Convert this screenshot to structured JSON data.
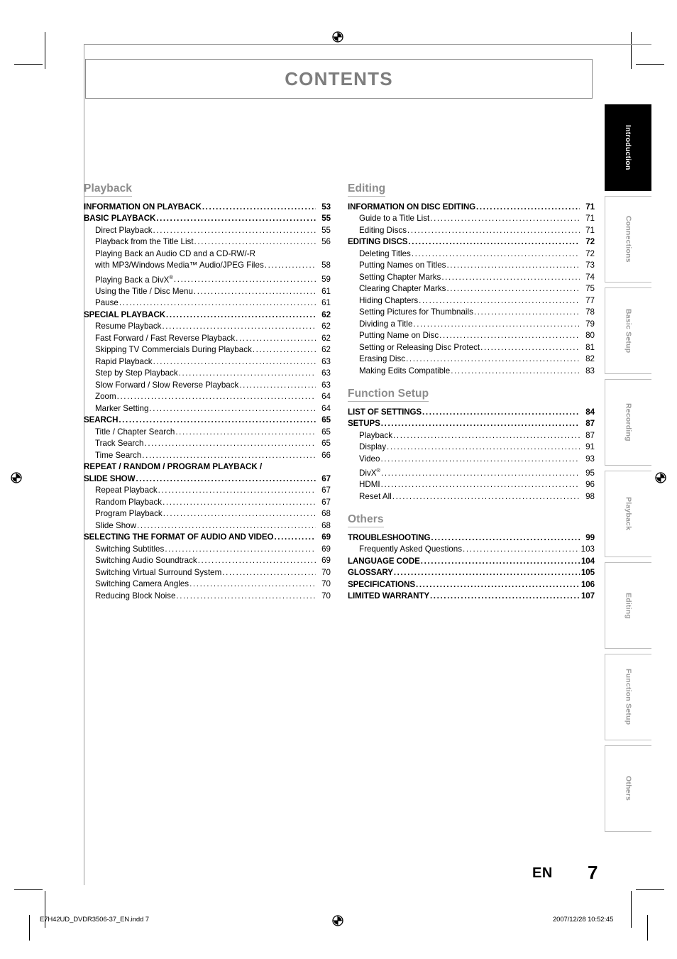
{
  "header": {
    "title": "CONTENTS"
  },
  "page": {
    "lang_code": "EN",
    "number": "7"
  },
  "footer": {
    "file_info": "E7H42UD_DVDR3506-37_EN.indd   7",
    "timestamp": "2007/12/28   10:52:45"
  },
  "tabs": [
    {
      "label": "Introduction",
      "active": true
    },
    {
      "label": "Connections",
      "active": false
    },
    {
      "label": "Basic Setup",
      "active": false
    },
    {
      "label": "Recording",
      "active": false
    },
    {
      "label": "Playback",
      "active": false
    },
    {
      "label": "Editing",
      "active": false
    },
    {
      "label": "Function Setup",
      "active": false
    },
    {
      "label": "Others",
      "active": false
    }
  ],
  "columns": [
    {
      "sections": [
        {
          "heading": "Playback",
          "entries": [
            {
              "level": 1,
              "label": "INFORMATION ON PLAYBACK",
              "page": "53"
            },
            {
              "level": 1,
              "label": "BASIC PLAYBACK",
              "page": "55"
            },
            {
              "level": 2,
              "label": "Direct Playback",
              "page": "55"
            },
            {
              "level": 2,
              "label": "Playback from the Title List",
              "page": "56"
            },
            {
              "level": 2,
              "label": "Playing Back an Audio CD and a CD-RW/-R",
              "page": "",
              "wrap": true
            },
            {
              "level": 2,
              "label": "with MP3/Windows Media™ Audio/JPEG Files",
              "page": "58"
            },
            {
              "level": 2,
              "label": "Playing Back a DivX",
              "sup": "®",
              "page": "59"
            },
            {
              "level": 2,
              "label": "Using the Title / Disc Menu",
              "page": "61"
            },
            {
              "level": 2,
              "label": "Pause",
              "page": "61"
            },
            {
              "level": 1,
              "label": "SPECIAL PLAYBACK",
              "page": "62"
            },
            {
              "level": 2,
              "label": "Resume Playback",
              "page": "62"
            },
            {
              "level": 2,
              "label": "Fast Forward / Fast Reverse Playback",
              "page": "62"
            },
            {
              "level": 2,
              "label": "Skipping TV Commercials During Playback",
              "page": "62"
            },
            {
              "level": 2,
              "label": "Rapid Playback",
              "page": "63"
            },
            {
              "level": 2,
              "label": "Step by Step Playback",
              "page": "63"
            },
            {
              "level": 2,
              "label": "Slow Forward / Slow Reverse Playback",
              "page": "63"
            },
            {
              "level": 2,
              "label": "Zoom",
              "page": "64"
            },
            {
              "level": 2,
              "label": "Marker Setting",
              "page": "64"
            },
            {
              "level": 1,
              "label": "SEARCH",
              "page": "65"
            },
            {
              "level": 2,
              "label": "Title / Chapter Search",
              "page": "65"
            },
            {
              "level": 2,
              "label": "Track Search",
              "page": "65"
            },
            {
              "level": 2,
              "label": "Time Search",
              "page": "66"
            },
            {
              "level": 1,
              "label": "REPEAT / RANDOM / PROGRAM PLAYBACK /",
              "page": "",
              "wrap": true
            },
            {
              "level": 1,
              "label": "SLIDE SHOW",
              "page": "67"
            },
            {
              "level": 2,
              "label": "Repeat Playback",
              "page": "67"
            },
            {
              "level": 2,
              "label": "Random Playback",
              "page": "67"
            },
            {
              "level": 2,
              "label": "Program Playback",
              "page": "68"
            },
            {
              "level": 2,
              "label": "Slide Show",
              "page": "68"
            },
            {
              "level": 1,
              "label": "SELECTING THE FORMAT OF AUDIO AND VIDEO",
              "page": "69"
            },
            {
              "level": 2,
              "label": "Switching Subtitles",
              "page": "69"
            },
            {
              "level": 2,
              "label": "Switching Audio Soundtrack",
              "page": "69"
            },
            {
              "level": 2,
              "label": "Switching Virtual Surround System",
              "page": "70"
            },
            {
              "level": 2,
              "label": "Switching Camera Angles",
              "page": "70"
            },
            {
              "level": 2,
              "label": "Reducing Block Noise",
              "page": "70"
            }
          ]
        }
      ]
    },
    {
      "sections": [
        {
          "heading": "Editing",
          "entries": [
            {
              "level": 1,
              "label": "INFORMATION ON DISC EDITING",
              "page": "71"
            },
            {
              "level": 2,
              "label": "Guide to a Title List",
              "page": "71"
            },
            {
              "level": 2,
              "label": "Editing Discs",
              "page": "71"
            },
            {
              "level": 1,
              "label": "EDITING DISCS",
              "page": "72"
            },
            {
              "level": 2,
              "label": "Deleting Titles",
              "page": "72"
            },
            {
              "level": 2,
              "label": "Putting Names on Titles",
              "page": "73"
            },
            {
              "level": 2,
              "label": "Setting Chapter Marks",
              "page": "74"
            },
            {
              "level": 2,
              "label": "Clearing Chapter Marks",
              "page": "75"
            },
            {
              "level": 2,
              "label": "Hiding Chapters",
              "page": "77"
            },
            {
              "level": 2,
              "label": "Setting Pictures for Thumbnails",
              "page": "78"
            },
            {
              "level": 2,
              "label": "Dividing a Title",
              "page": "79"
            },
            {
              "level": 2,
              "label": "Putting Name on Disc",
              "page": "80"
            },
            {
              "level": 2,
              "label": "Setting or Releasing Disc Protect",
              "page": "81"
            },
            {
              "level": 2,
              "label": "Erasing Disc",
              "page": "82"
            },
            {
              "level": 2,
              "label": "Making Edits Compatible",
              "page": "83"
            }
          ]
        },
        {
          "heading": "Function Setup",
          "entries": [
            {
              "level": 1,
              "label": "LIST OF SETTINGS",
              "page": "84"
            },
            {
              "level": 1,
              "label": "SETUPS",
              "page": "87"
            },
            {
              "level": 2,
              "label": "Playback",
              "page": "87"
            },
            {
              "level": 2,
              "label": "Display",
              "page": "91"
            },
            {
              "level": 2,
              "label": "Video",
              "page": "93"
            },
            {
              "level": 2,
              "label": "DivX",
              "sup": "®",
              "page": "95"
            },
            {
              "level": 2,
              "label": "HDMI",
              "page": "96"
            },
            {
              "level": 2,
              "label": "Reset All",
              "page": "98"
            }
          ]
        },
        {
          "heading": "Others",
          "entries": [
            {
              "level": 1,
              "label": "TROUBLESHOOTING",
              "page": "99"
            },
            {
              "level": 2,
              "label": "Frequently Asked Questions",
              "page": "103"
            },
            {
              "level": 1,
              "label": "LANGUAGE CODE",
              "page": "104"
            },
            {
              "level": 1,
              "label": "GLOSSARY",
              "page": "105"
            },
            {
              "level": 1,
              "label": "SPECIFICATIONS",
              "page": "106"
            },
            {
              "level": 1,
              "label": "LIMITED WARRANTY",
              "page": "107"
            }
          ]
        }
      ]
    }
  ],
  "colors": {
    "heading_gray": "#8c8c8c",
    "tab_active_bg": "#000000",
    "tab_inactive_text": "#9a9a9a",
    "frame_gray": "#999999"
  }
}
